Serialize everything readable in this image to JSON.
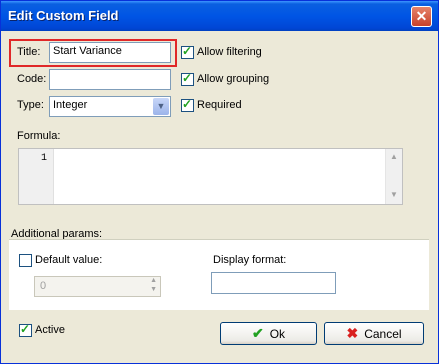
{
  "window": {
    "title": "Edit Custom Field",
    "close_glyph": "✕"
  },
  "form": {
    "title_label": "Title:",
    "title_value": "Start Variance",
    "code_label": "Code:",
    "code_value": "",
    "type_label": "Type:",
    "type_value": "Integer",
    "allow_filtering": {
      "label": "Allow filtering",
      "checked": true
    },
    "allow_grouping": {
      "label": "Allow grouping",
      "checked": true
    },
    "required": {
      "label": "Required",
      "checked": true
    },
    "formula_label": "Formula:",
    "formula_line_number": "1"
  },
  "params": {
    "section_label": "Additional params:",
    "default_value": {
      "label": "Default value:",
      "checked": false,
      "value": "0"
    },
    "display_format": {
      "label": "Display format:",
      "value": ""
    }
  },
  "footer": {
    "active": {
      "label": "Active",
      "checked": true
    },
    "ok_label": "Ok",
    "cancel_label": "Cancel"
  }
}
